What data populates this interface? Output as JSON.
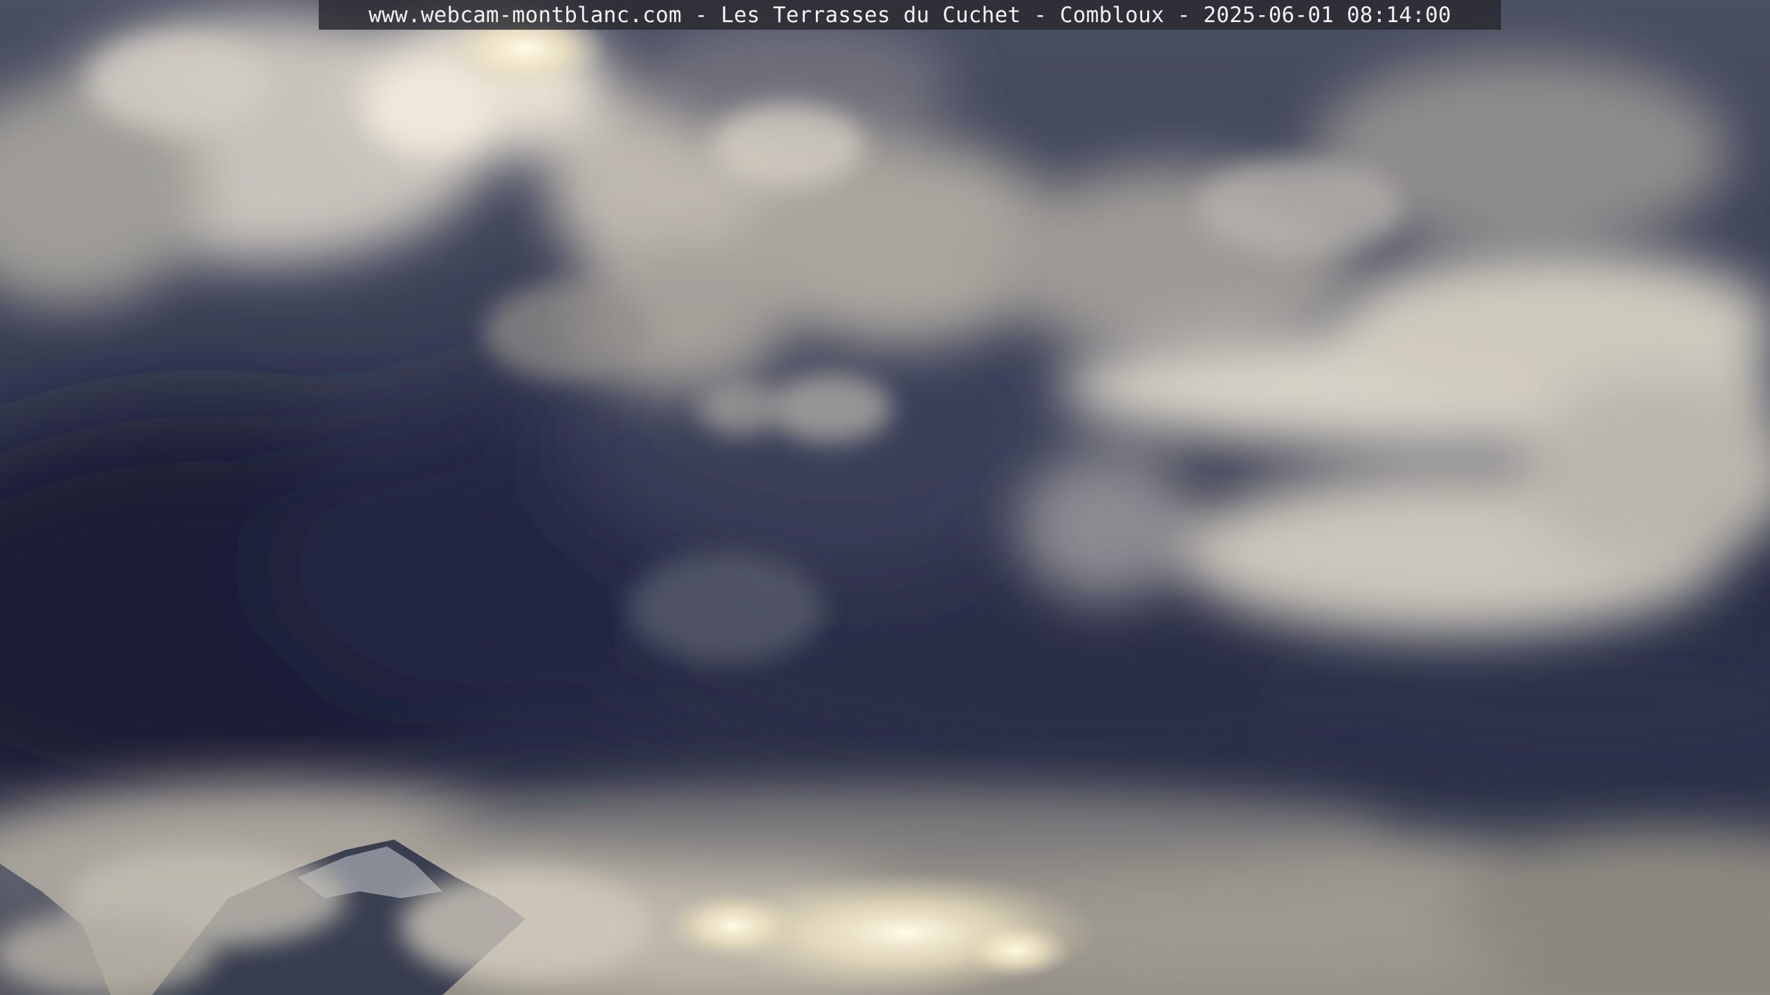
{
  "overlay": {
    "caption": "www.webcam-montblanc.com - Les Terrasses du Cuchet - Combloux - 2025-06-01 08:14:00"
  },
  "colors": {
    "dark_cloud": "#1e2238",
    "mid_cloud": "#5a5f72",
    "light_cloud": "#d9d3c5",
    "sun_glow": "#fff6d8",
    "caption_bg": "#28282e",
    "caption_text": "#f2f2f2"
  }
}
